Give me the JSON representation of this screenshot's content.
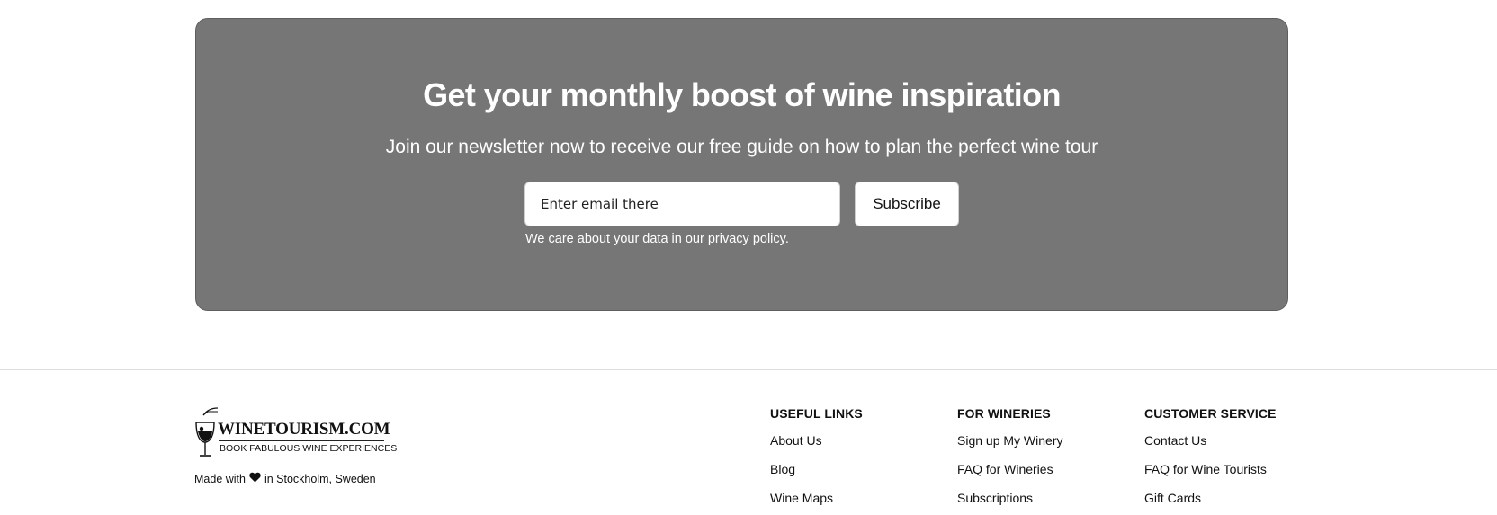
{
  "newsletter": {
    "title": "Get your monthly boost of wine inspiration",
    "subtitle": "Join our newsletter now to receive our free guide on how to plan the perfect wine tour",
    "email_placeholder": "Enter email there",
    "email_value": "",
    "subscribe_label": "Subscribe",
    "privacy_prefix": "We care about your data in our ",
    "privacy_link": "privacy policy",
    "privacy_suffix": "."
  },
  "footer": {
    "logo": {
      "name": "WINETOURISM.COM",
      "tagline": "BOOK FABULOUS WINE EXPERIENCES",
      "icon": "wine-glass-icon"
    },
    "made_with": {
      "prefix": "Made with",
      "icon": "heart-icon",
      "suffix": "in Stockholm, Sweden"
    },
    "columns": [
      {
        "heading": "USEFUL LINKS",
        "links": [
          "About Us",
          "Blog",
          "Wine Maps"
        ]
      },
      {
        "heading": "FOR WINERIES",
        "links": [
          "Sign up My Winery",
          "FAQ for Wineries",
          "Subscriptions"
        ]
      },
      {
        "heading": "CUSTOMER SERVICE",
        "links": [
          "Contact Us",
          "FAQ for Wine Tourists",
          "Gift Cards"
        ]
      }
    ]
  },
  "colors": {
    "newsletter_background": "#767676",
    "text_on_dark": "#ffffff",
    "footer_text": "#111111",
    "divider": "#dddddd"
  }
}
